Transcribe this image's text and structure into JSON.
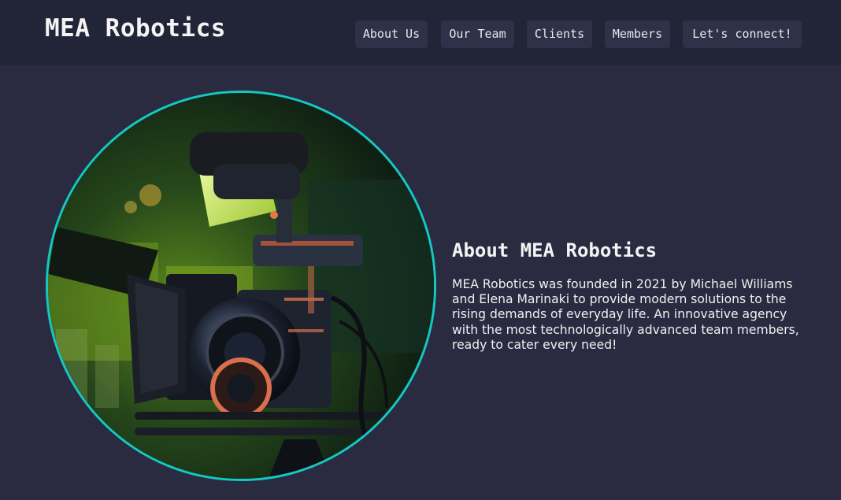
{
  "header": {
    "brand": "MEA Robotics",
    "nav": [
      {
        "label": "About Us"
      },
      {
        "label": "Our Team"
      },
      {
        "label": "Clients"
      },
      {
        "label": "Members"
      },
      {
        "label": "Let's connect!"
      }
    ]
  },
  "about": {
    "title": "About MEA Robotics",
    "body": "MEA Robotics was founded in 2021 by Michael Williams and Elena Marinaki to provide modern solutions to the rising demands of everyday life. An innovative agency with the most technologically advanced team members, ready to cater every need!"
  },
  "theme": {
    "page_bg": "#2a2b40",
    "header_bg": "#222438",
    "nav_button_bg": "#2f3149",
    "image_ring": "#14c8c4"
  },
  "image": {
    "subject": "cinema-camera-photo"
  }
}
